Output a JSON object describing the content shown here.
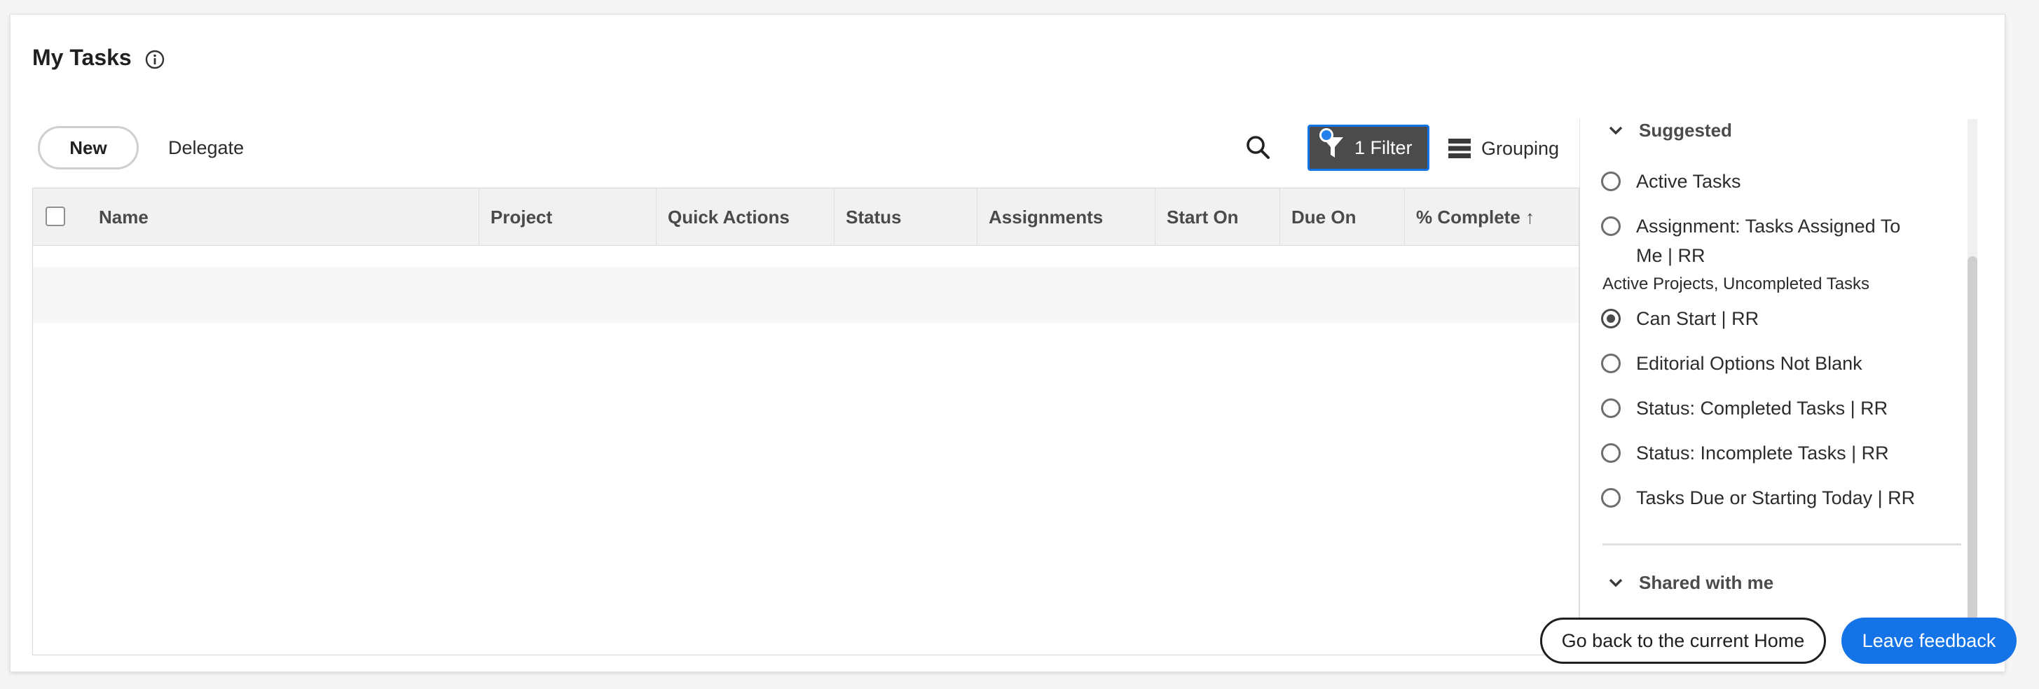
{
  "page": {
    "title": "My Tasks"
  },
  "toolbar": {
    "new_label": "New",
    "delegate_label": "Delegate",
    "filter_label": "1 Filter",
    "grouping_label": "Grouping"
  },
  "table": {
    "columns": [
      "Name",
      "Project",
      "Quick Actions",
      "Status",
      "Assignments",
      "Start On",
      "Due On",
      "% Complete ↑"
    ]
  },
  "filter_panel": {
    "suggested_header": "Suggested",
    "items": [
      {
        "label": "Active Tasks",
        "checked": false
      },
      {
        "label": "Assignment: Tasks Assigned To Me | RR",
        "checked": false
      },
      {
        "label": "Can Start | RR",
        "checked": true
      },
      {
        "label": "Editorial Options Not Blank",
        "checked": false
      },
      {
        "label": "Status: Completed Tasks | RR",
        "checked": false
      },
      {
        "label": "Status: Incomplete Tasks | RR",
        "checked": false
      },
      {
        "label": "Tasks Due or Starting Today | RR",
        "checked": false
      }
    ],
    "sub_label": "Active Projects, Uncompleted Tasks",
    "shared_header": "Shared with me"
  },
  "footer": {
    "home_label": "Go back to the current Home",
    "feedback_label": "Leave feedback"
  },
  "colors": {
    "accent": "#1473e6",
    "filter_bg": "#4b4b4b",
    "header_bg": "#f1f1f1"
  }
}
